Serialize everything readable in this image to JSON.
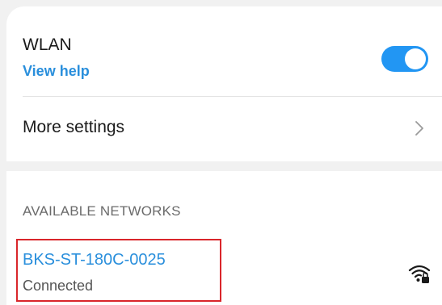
{
  "wlan": {
    "title": "WLAN",
    "help_link": "View help",
    "enabled": true,
    "accent_color": "#2296f3"
  },
  "more_settings": {
    "label": "More settings",
    "icon": "chevron-right-icon"
  },
  "available_networks": {
    "header": "AVAILABLE NETWORKS",
    "items": [
      {
        "name": "BKS-ST-180C-0025",
        "status": "Connected",
        "icon": "wifi-locked-icon",
        "highlight_color": "#d9262b"
      }
    ]
  }
}
